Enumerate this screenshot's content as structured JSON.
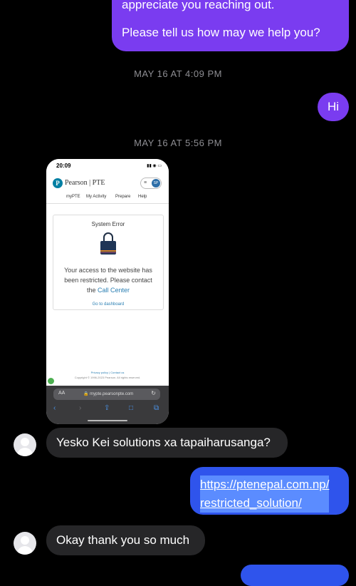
{
  "messages": {
    "top_bubble_line1": "appreciate you reaching out.",
    "top_bubble_line2": "Please tell us how may we help you?",
    "timestamp1": "MAY 16 AT 4:09 PM",
    "hi": "Hi",
    "timestamp2": "MAY 16 AT 5:56 PM",
    "incoming1": "Yesko Kei solutions xa tapaiharusanga?",
    "link_line1": "https://ptenepal.com.np/",
    "link_line2": "restricted_solution/",
    "incoming2": "Okay thank you so much"
  },
  "screenshot": {
    "time": "20:09",
    "status_icons": "▮▮ ◉ ▭",
    "brand": "Pearson | PTE",
    "logo_letter": "P",
    "avatar_initials": "SP",
    "menu_icon": "≡",
    "nav": [
      "myPTE",
      "My Activity",
      "Prepare",
      "Help"
    ],
    "card_title": "System Error",
    "error_line1": "Your access to the website has",
    "error_line2": "been restricted. Please contact",
    "error_line3_prefix": "the ",
    "error_link": "Call Center",
    "dashboard_link": "Go to dashboard",
    "footer_links": "Privacy policy | Contact us",
    "copyright": "Copyright © 1996-2023 Pearson. All rights reserved.",
    "aa": "AA",
    "url": "🔒 mypte.pearsonpte.com",
    "reload_icon": "↻",
    "back_icon": "‹",
    "forward_icon": "›",
    "share_icon": "⇪",
    "book_icon": "□",
    "tabs_icon": "⧉"
  },
  "colors": {
    "outgoing_purple": "#7a3cf0",
    "outgoing_blue": "#2f54ec",
    "incoming_gray": "#262628",
    "timestamp": "#8e8e93"
  }
}
